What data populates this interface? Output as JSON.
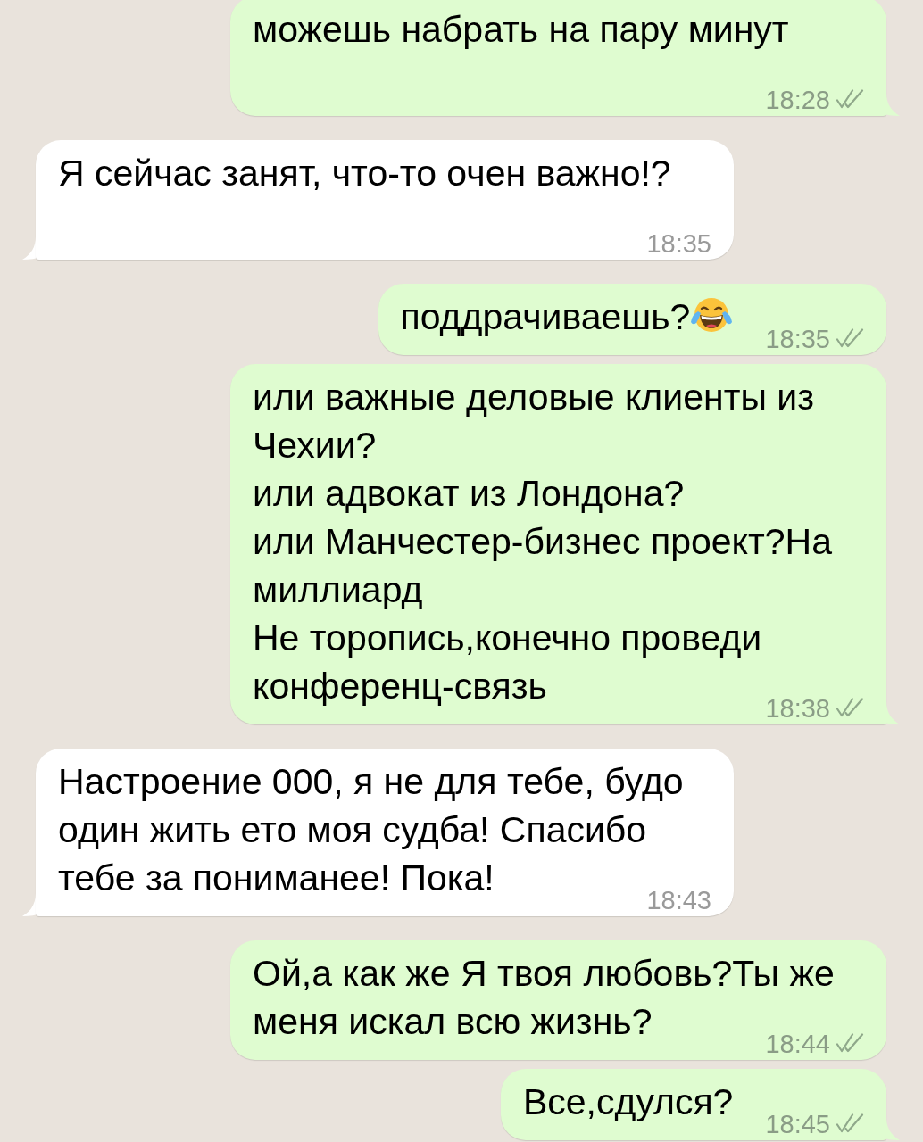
{
  "messages": [
    {
      "kind": "outgoing",
      "text": "можешь набрать на пару минут",
      "time": "18:28",
      "read": false
    },
    {
      "kind": "incoming",
      "text": "Я сейчас занят, что-то очен важно!?",
      "time": "18:35"
    },
    {
      "kind": "outgoing",
      "text": "поддрачиваешь?",
      "emoji": {
        "kind": "tears_of_joy"
      },
      "time": "18:35",
      "read": false
    },
    {
      "kind": "outgoing",
      "text": "или важные деловые клиенты из Чехии?\nили адвокат из Лондона?\nили Манчестер-бизнес проект?На миллиард\nНе торопись,конечно проведи конференц-связь",
      "time": "18:38",
      "read": false
    },
    {
      "kind": "incoming",
      "text": "Настроение 000, я не для тебе, будо один жить ето моя судба! Спасибо тебе за пониманее! Пока!",
      "time": "18:43"
    },
    {
      "kind": "outgoing",
      "text": "Ой,а как же Я твоя любовь?Ты же меня искал всю жизнь?",
      "time": "18:44",
      "read": false
    },
    {
      "kind": "outgoing",
      "text": "Все,сдулся?",
      "time": "18:45",
      "read": false
    }
  ]
}
